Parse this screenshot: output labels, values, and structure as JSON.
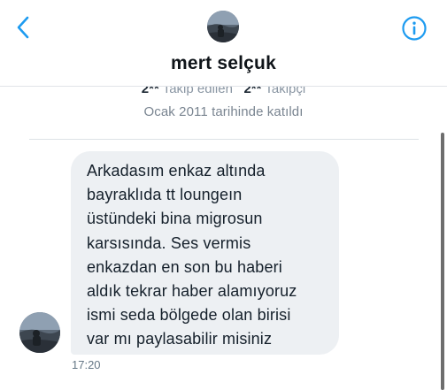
{
  "header": {
    "name": "mert selçuk",
    "back_icon": "chevron-left-icon",
    "info_icon": "info-circle-icon",
    "accent_color": "#1d9bf0"
  },
  "profile": {
    "following_count": "2**",
    "following_label": "Takip edilen",
    "followers_count": "2**",
    "followers_label": "Takipçi",
    "joined": "Ocak 2011 tarihinde katıldı"
  },
  "message": {
    "lines": [
      "Arkadasım enkaz altında",
      "bayraklıda tt loungeın",
      "üstündeki bina migrosun",
      "karsısında. Ses vermis",
      "enkazdan en son bu haberi",
      "aldık tekrar haber alamıyoruz",
      "ismi seda bölgede olan birisi",
      "var mı paylasabilir misiniz"
    ],
    "time": "17:20"
  }
}
